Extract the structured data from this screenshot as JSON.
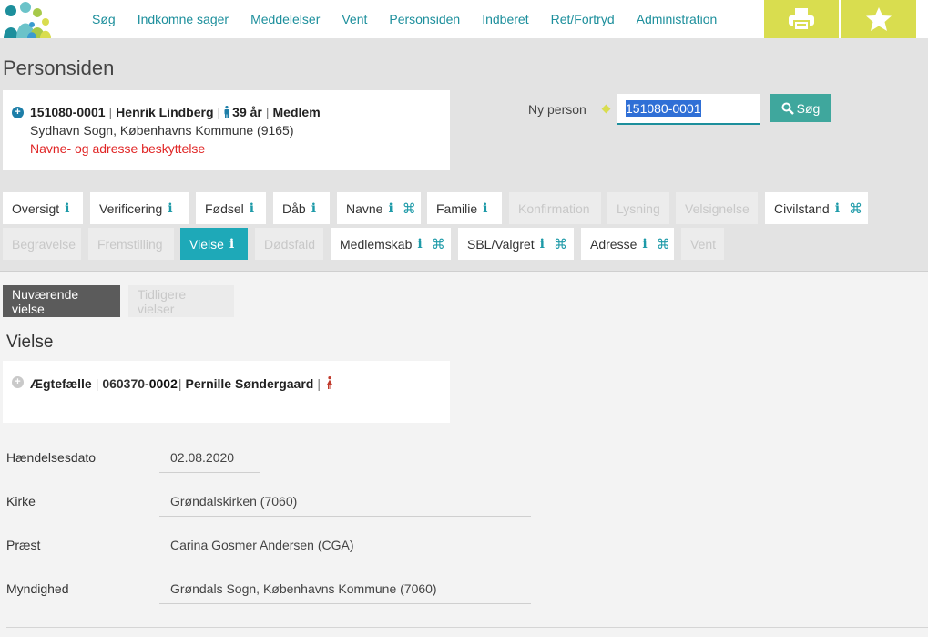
{
  "nav": {
    "items": [
      "Søg",
      "Indkomne sager",
      "Meddelelser",
      "Vent",
      "Personsiden",
      "Indberet",
      "Ret/Fortryd",
      "Administration"
    ],
    "print_icon": "printer-icon",
    "star_icon": "star-icon"
  },
  "page": {
    "title": "Personsiden"
  },
  "person": {
    "cpr": "151080-0001",
    "name": "Henrik Lindberg",
    "age": "39 år",
    "status": "Medlem",
    "address": "Sydhavn Sogn, Københavns Kommune (9165)",
    "protection": "Navne- og adresse beskyttelse"
  },
  "search": {
    "label": "Ny person",
    "value": "151080-0001",
    "button": "Søg"
  },
  "tabs_row1": [
    {
      "label": "Oversigt",
      "info": true,
      "cmd": false,
      "state": "normal"
    },
    {
      "label": "Verificering",
      "info": true,
      "cmd": false,
      "state": "normal"
    },
    {
      "label": "Fødsel",
      "info": true,
      "cmd": false,
      "state": "normal"
    },
    {
      "label": "Dåb",
      "info": true,
      "cmd": false,
      "state": "normal"
    },
    {
      "label": "Navne",
      "info": true,
      "cmd": true,
      "state": "normal"
    },
    {
      "label": "Familie",
      "info": true,
      "cmd": false,
      "state": "normal"
    },
    {
      "label": "Konfirmation",
      "info": false,
      "cmd": false,
      "state": "disabled"
    },
    {
      "label": "Lysning",
      "info": false,
      "cmd": false,
      "state": "disabled"
    },
    {
      "label": "Velsignelse",
      "info": false,
      "cmd": false,
      "state": "disabled"
    },
    {
      "label": "Civilstand",
      "info": true,
      "cmd": true,
      "state": "normal"
    }
  ],
  "tabs_row2": [
    {
      "label": "Begravelse",
      "info": false,
      "cmd": false,
      "state": "disabled"
    },
    {
      "label": "Fremstilling",
      "info": false,
      "cmd": false,
      "state": "disabled"
    },
    {
      "label": "Vielse",
      "info": true,
      "cmd": false,
      "state": "active"
    },
    {
      "label": "Dødsfald",
      "info": false,
      "cmd": false,
      "state": "disabled"
    },
    {
      "label": "Medlemskab",
      "info": true,
      "cmd": true,
      "state": "normal"
    },
    {
      "label": "SBL/Valgret",
      "info": true,
      "cmd": true,
      "state": "normal"
    },
    {
      "label": "Adresse",
      "info": true,
      "cmd": true,
      "state": "normal"
    },
    {
      "label": "Vent",
      "info": false,
      "cmd": false,
      "state": "disabled"
    }
  ],
  "tab_glyphs": {
    "info": "i",
    "cmd": "⌘"
  },
  "subtabs": {
    "current": "Nuværende vielse",
    "previous": "Tidligere vielser"
  },
  "section": {
    "title": "Vielse"
  },
  "spouse": {
    "role": "Ægtefælle",
    "cpr_prefix": "060370-",
    "cpr_suffix": "0002",
    "name": "Pernille Søndergaard"
  },
  "fields": [
    {
      "label": "Hændelsesdato",
      "value": "02.08.2020"
    },
    {
      "label": "Kirke",
      "value": "Grøndalskirken (7060)"
    },
    {
      "label": "Præst",
      "value": "Carina Gosmer Andersen (CGA)"
    },
    {
      "label": "Myndighed",
      "value": "Grøndals Sogn, Københavns Kommune (7060)"
    }
  ],
  "colors": {
    "accent": "#1d8f9c",
    "active_tab": "#1ea9b8",
    "nav_button": "#d9dd4f",
    "warning": "#e02626"
  }
}
